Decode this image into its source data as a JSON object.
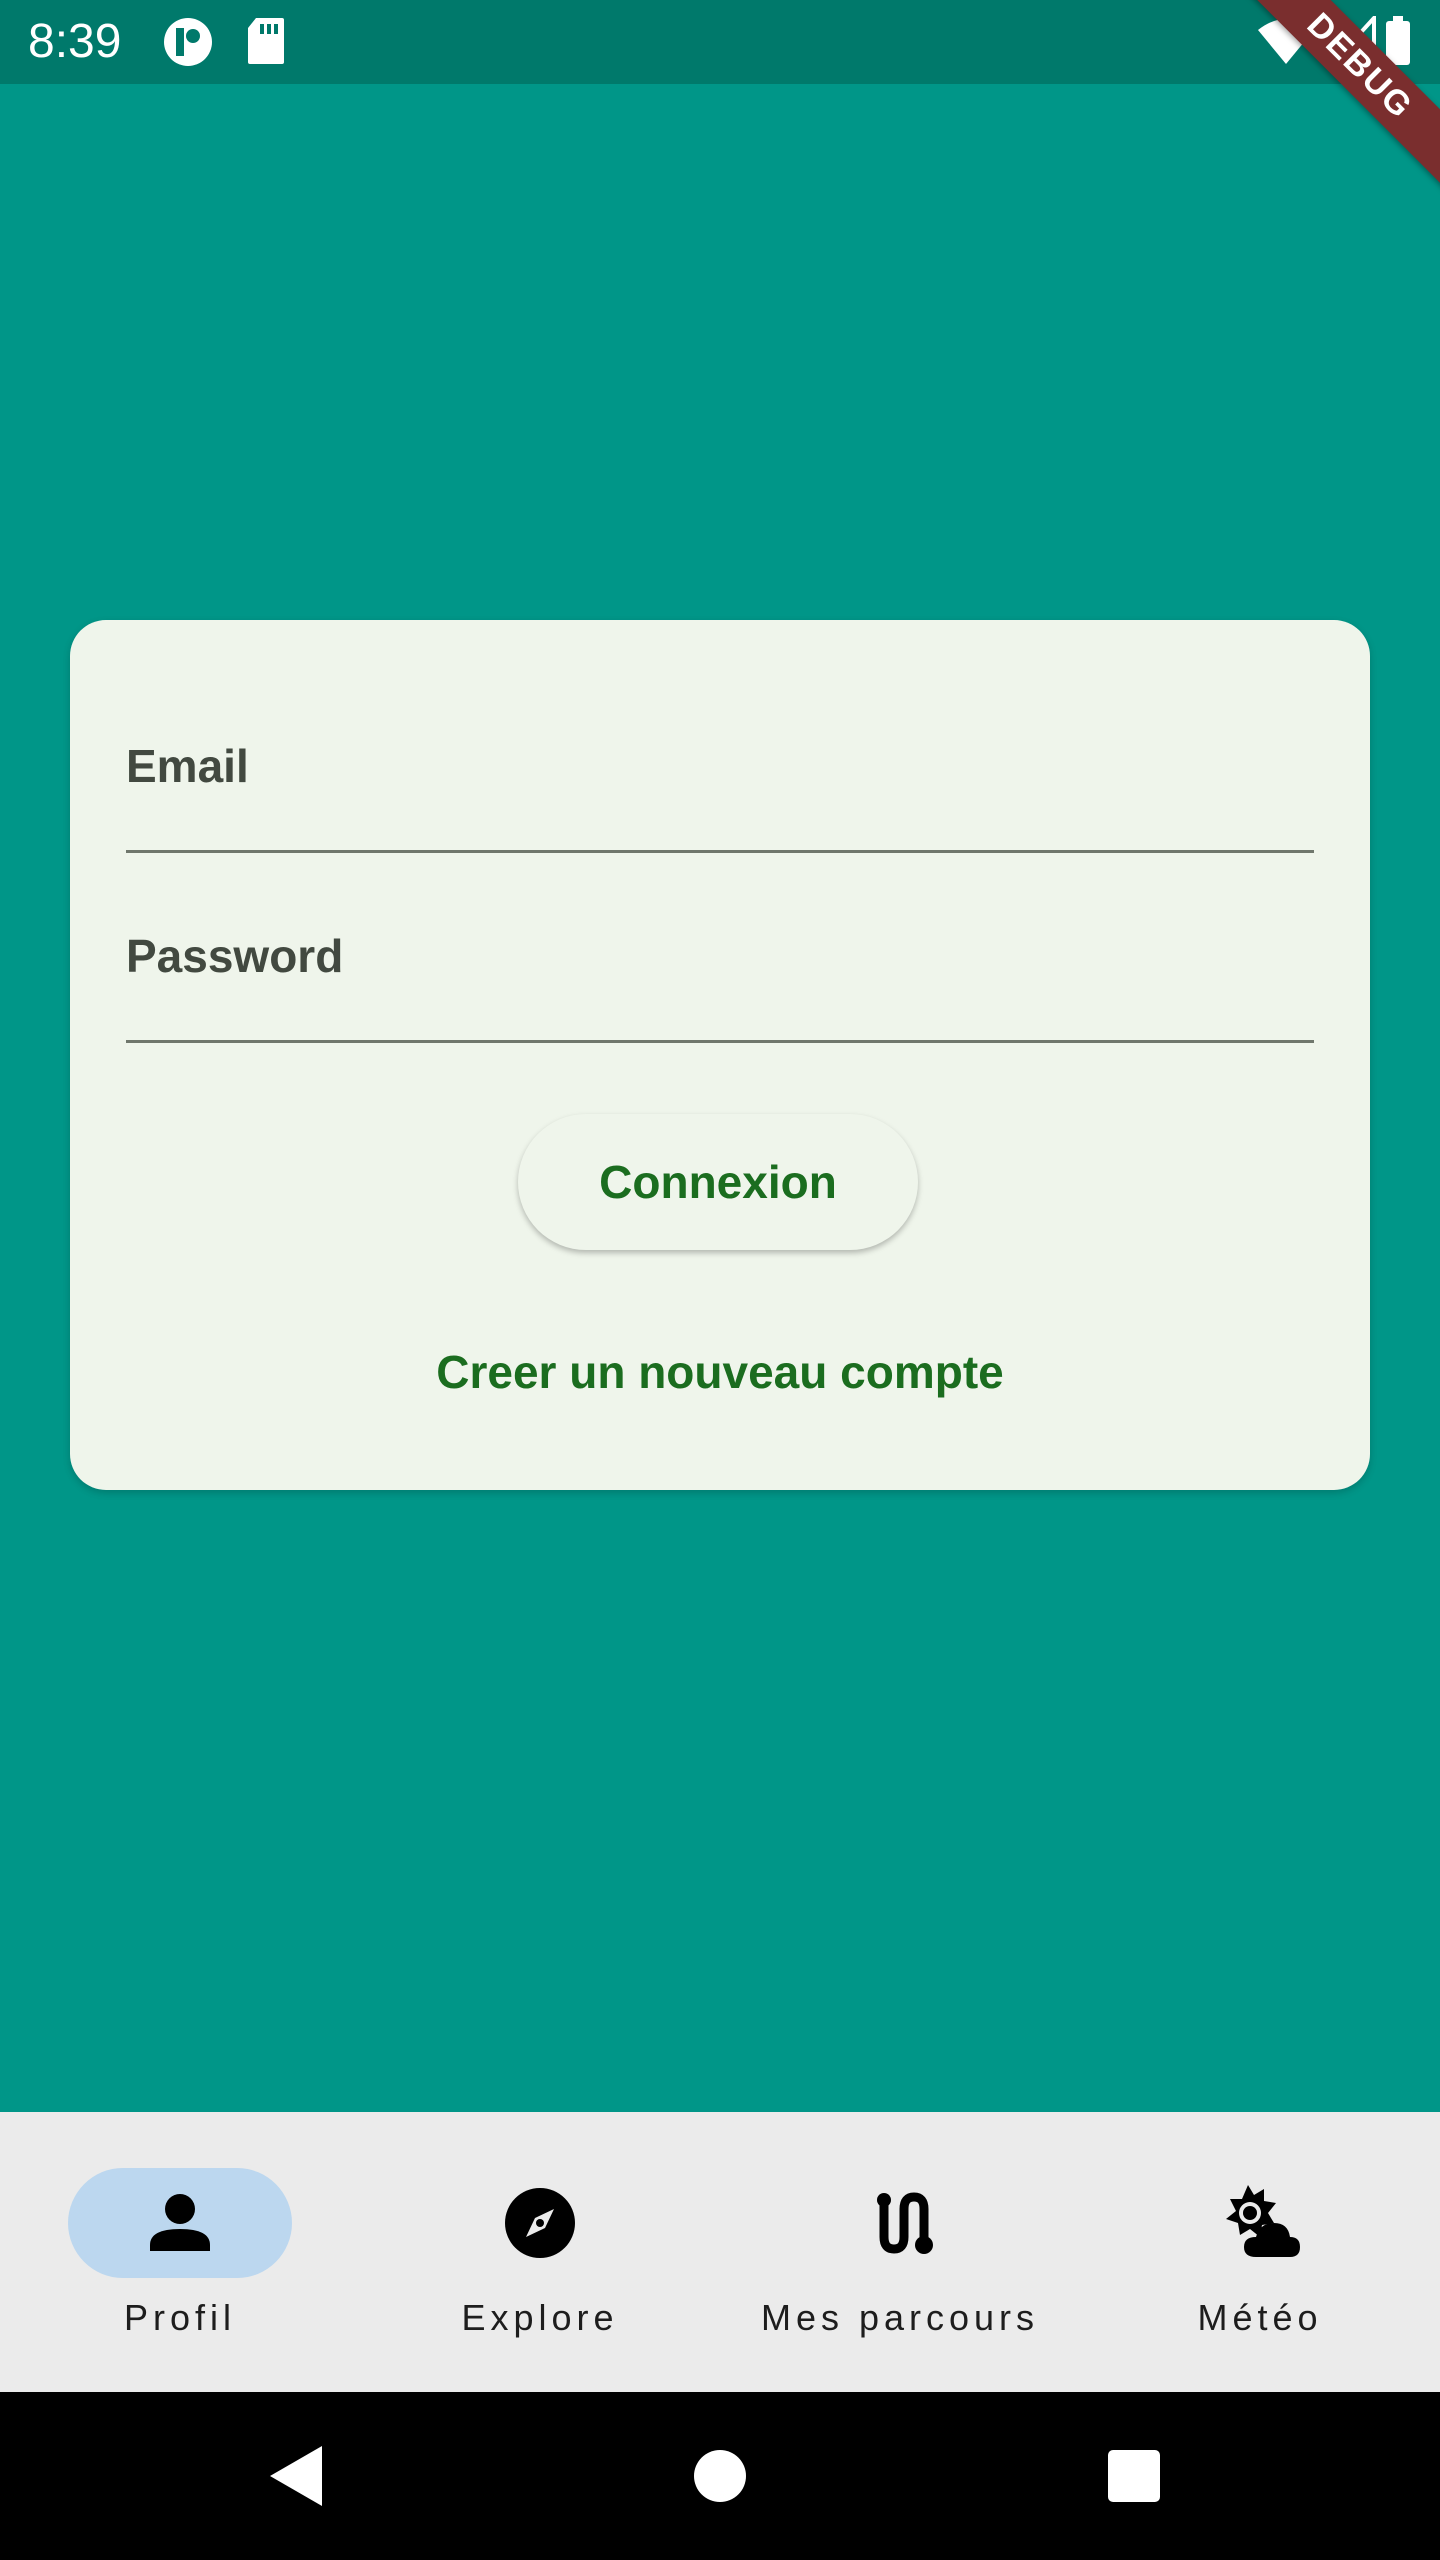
{
  "status_bar": {
    "time": "8:39",
    "icons": [
      "app-notification-icon",
      "sd-card-icon",
      "wifi-icon",
      "cell-signal-icon",
      "battery-icon"
    ],
    "debug_label": "DEBUG"
  },
  "login_card": {
    "email": {
      "label": "Email",
      "value": ""
    },
    "password": {
      "label": "Password",
      "value": ""
    },
    "connexion_label": "Connexion",
    "create_account_label": "Creer un nouveau compte"
  },
  "bottom_nav": {
    "items": [
      {
        "label": "Profil",
        "icon": "person-icon",
        "active": true
      },
      {
        "label": "Explore",
        "icon": "compass-icon",
        "active": false
      },
      {
        "label": "Mes parcours",
        "icon": "route-icon",
        "active": false
      },
      {
        "label": "Météo",
        "icon": "weather-icon",
        "active": false
      }
    ]
  },
  "system_nav": {
    "icons": [
      "back-icon",
      "home-icon",
      "recents-icon"
    ]
  },
  "colors": {
    "background": "#009688",
    "status_bar": "#00796b",
    "card": "#eff5eb",
    "accent_green": "#1b6d1f",
    "nav_active_pill": "#bcd7ef",
    "bottom_nav_bg": "#ebebeb"
  }
}
